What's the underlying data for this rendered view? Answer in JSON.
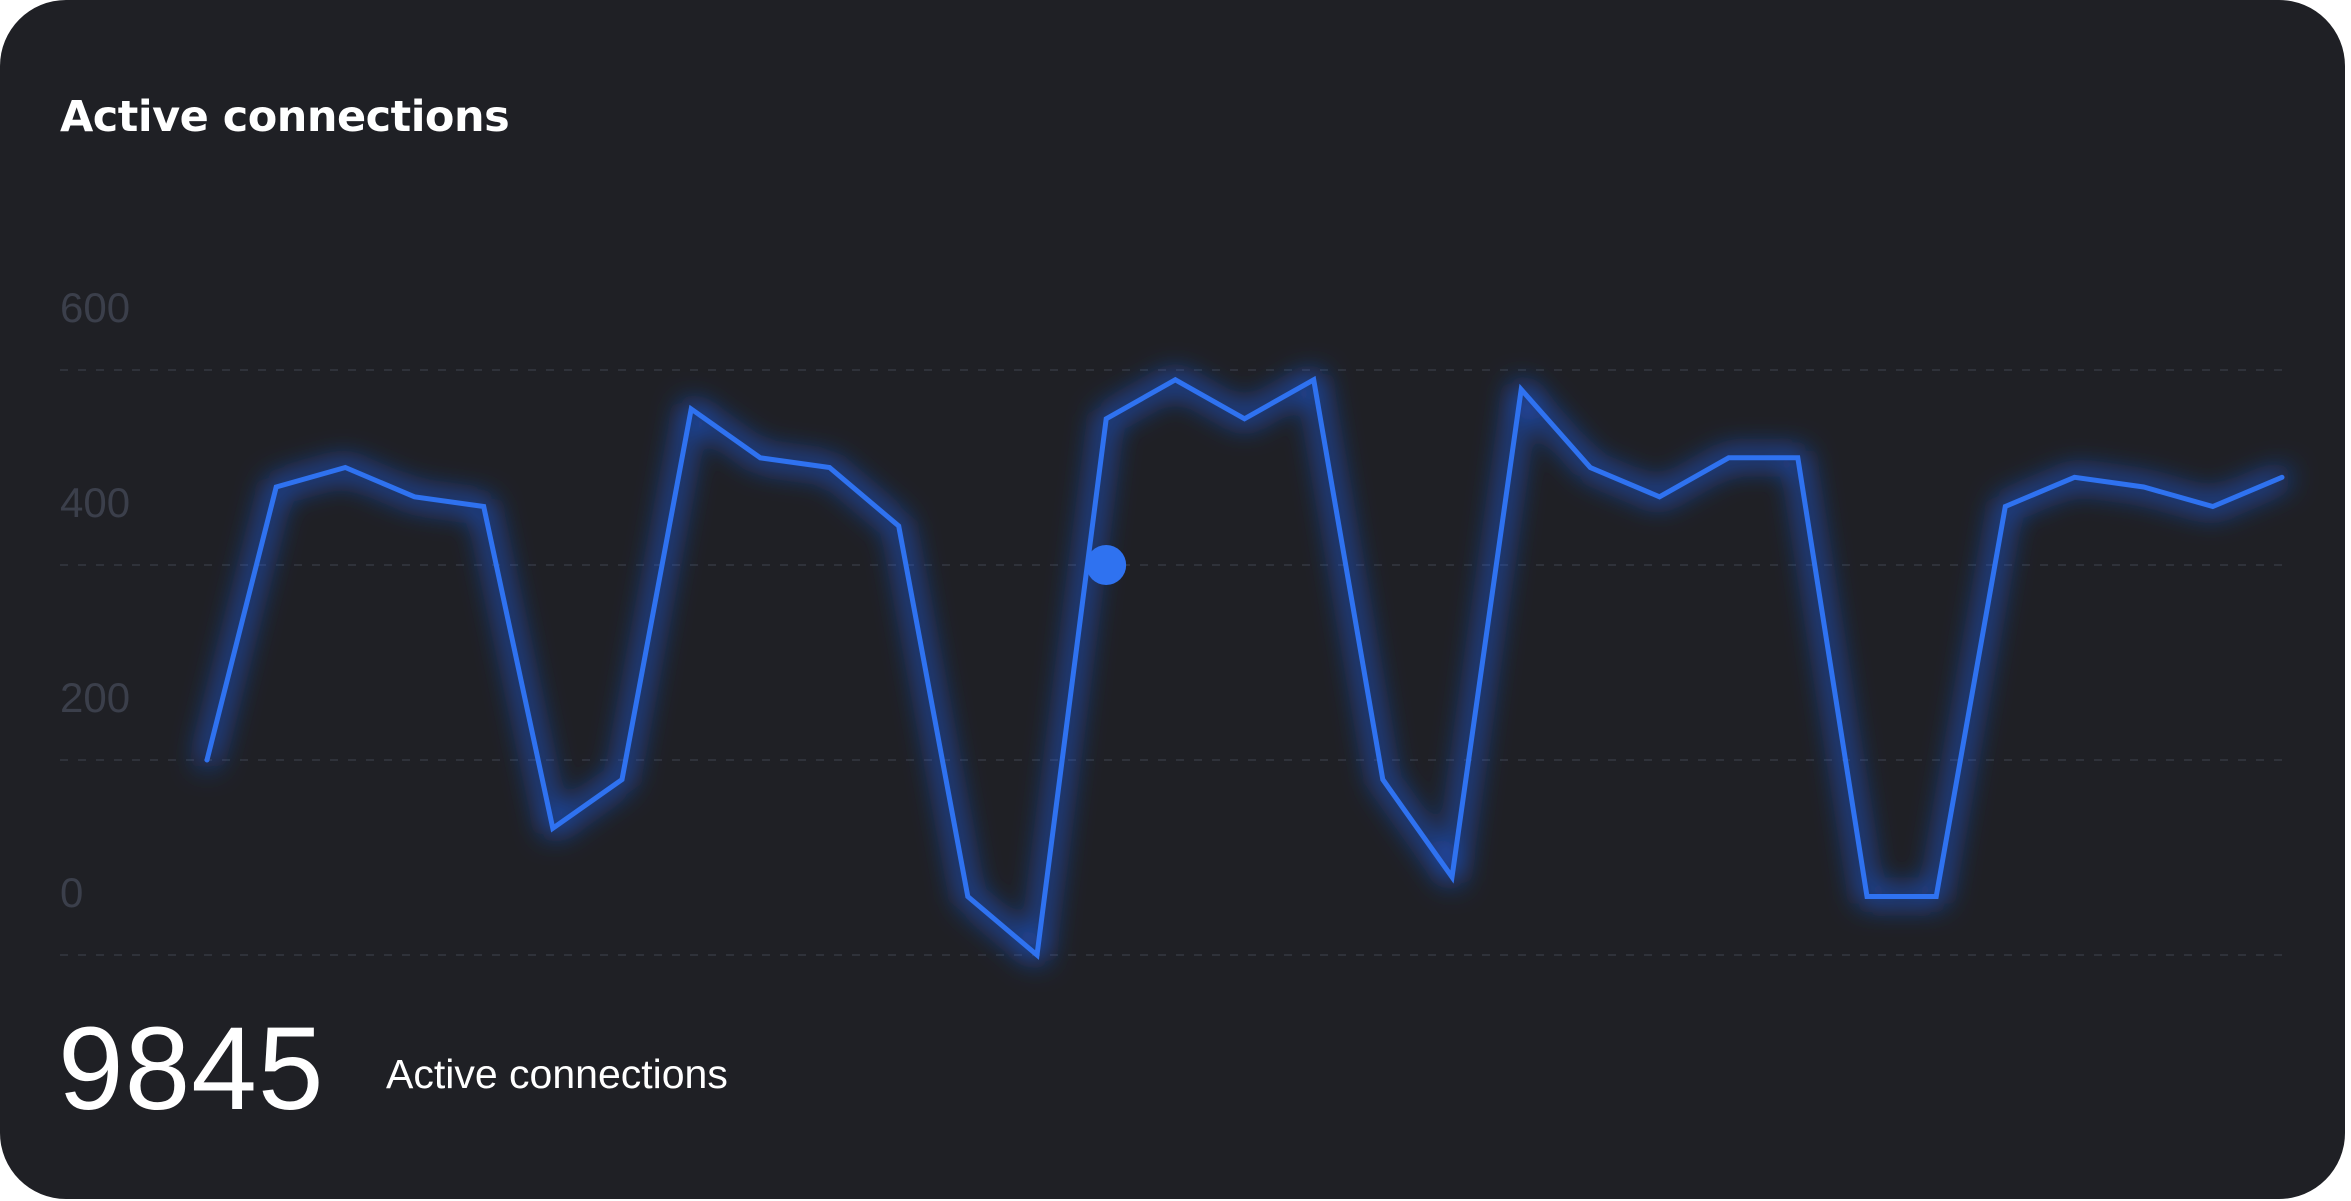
{
  "card": {
    "title": "Active connections"
  },
  "metric": {
    "value": "9845",
    "caption": "Active connections"
  },
  "colors": {
    "background": "#1f2025",
    "line": "#2f72f0",
    "glow": "#1f64ff",
    "tick_text": "#3b3f4b",
    "grid": "#2f323a",
    "title_text": "#ffffff"
  },
  "chart_data": {
    "type": "line",
    "title": "",
    "xlabel": "",
    "ylabel": "",
    "ylim": [
      0,
      600
    ],
    "yticks": [
      0,
      200,
      400,
      600
    ],
    "grid": true,
    "x": [
      1,
      2,
      3,
      4,
      5,
      6,
      7,
      8,
      9,
      10,
      11,
      12,
      13,
      14,
      15,
      16,
      17,
      18,
      19,
      20,
      21,
      22,
      23,
      24,
      25,
      26,
      27,
      28,
      29,
      30,
      31
    ],
    "series": [
      {
        "values": [
          200,
          480,
          500,
          470,
          460,
          130,
          180,
          560,
          510,
          500,
          440,
          60,
          0,
          550,
          590,
          550,
          590,
          180,
          80,
          580,
          500,
          470,
          510,
          510,
          60,
          60,
          460,
          490,
          480,
          460,
          490
        ]
      }
    ],
    "highlight": {
      "x": 14,
      "y": 400
    }
  }
}
